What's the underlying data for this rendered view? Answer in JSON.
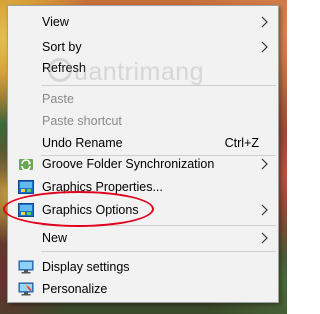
{
  "menu": {
    "items": [
      {
        "label": "View",
        "submenu": true,
        "disabled": false
      },
      {
        "label": "Sort by",
        "submenu": true,
        "disabled": false
      },
      {
        "label": "Refresh",
        "submenu": false,
        "disabled": false
      },
      {
        "label": "Paste",
        "submenu": false,
        "disabled": true
      },
      {
        "label": "Paste shortcut",
        "submenu": false,
        "disabled": true
      },
      {
        "label": "Undo Rename",
        "shortcut": "Ctrl+Z",
        "submenu": false,
        "disabled": false
      },
      {
        "label": "Groove Folder Synchronization",
        "submenu": true,
        "disabled": false,
        "icon": "groove-icon"
      },
      {
        "label": "Graphics Properties...",
        "submenu": false,
        "disabled": false,
        "icon": "intel-graphics-icon"
      },
      {
        "label": "Graphics Options",
        "submenu": true,
        "disabled": false,
        "icon": "intel-graphics-icon",
        "highlighted": true
      },
      {
        "label": "New",
        "submenu": true,
        "disabled": false
      },
      {
        "label": "Display settings",
        "submenu": false,
        "disabled": false,
        "icon": "display-icon"
      },
      {
        "label": "Personalize",
        "submenu": false,
        "disabled": false,
        "icon": "personalize-icon"
      }
    ]
  },
  "watermark": {
    "text": "uantrimang"
  },
  "colors": {
    "menu_bg": "#f2f2f2",
    "disabled_text": "#8a8a8a",
    "highlight_ring": "#e0001b"
  }
}
